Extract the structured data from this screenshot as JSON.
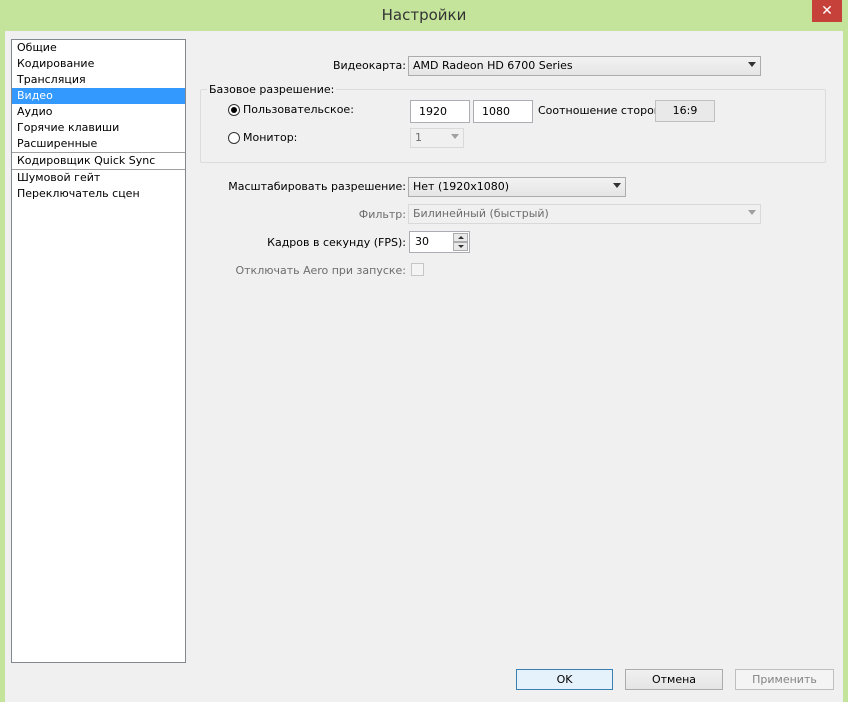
{
  "window": {
    "title": "Настройки",
    "close_glyph": "✕"
  },
  "sidebar": {
    "items": [
      {
        "label": "Общие"
      },
      {
        "label": "Кодирование"
      },
      {
        "label": "Трансляция"
      },
      {
        "label": "Видео",
        "selected": true
      },
      {
        "label": "Аудио"
      },
      {
        "label": "Горячие клавиши"
      },
      {
        "label": "Расширенные"
      },
      {
        "label": "Кодировщик Quick Sync"
      },
      {
        "label": "Шумовой гейт"
      },
      {
        "label": "Переключатель сцен"
      }
    ]
  },
  "video": {
    "gpu_label": "Видеокарта:",
    "gpu_value": "AMD Radeon HD 6700 Series",
    "base_res_title": "Базовое разрешение:",
    "custom_label": "Пользовательское:",
    "width_value": "1920",
    "height_value": "1080",
    "aspect_label": "Соотношение сторон:",
    "aspect_value": "16:9",
    "monitor_label": "Монитор:",
    "monitor_value": "1",
    "scale_label": "Масштабировать разрешение:",
    "scale_value": "Нет  (1920x1080)",
    "filter_label": "Фильтр:",
    "filter_value": "Билинейный (быстрый)",
    "fps_label": "Кадров в секунду (FPS):",
    "fps_value": "30",
    "aero_label": "Отключать Aero при запуске:"
  },
  "buttons": {
    "ok": "OK",
    "cancel": "Отмена",
    "apply": "Применить"
  },
  "colors": {
    "titlebar": "#c3e49a",
    "selection": "#3399ff",
    "close": "#c7413b"
  }
}
